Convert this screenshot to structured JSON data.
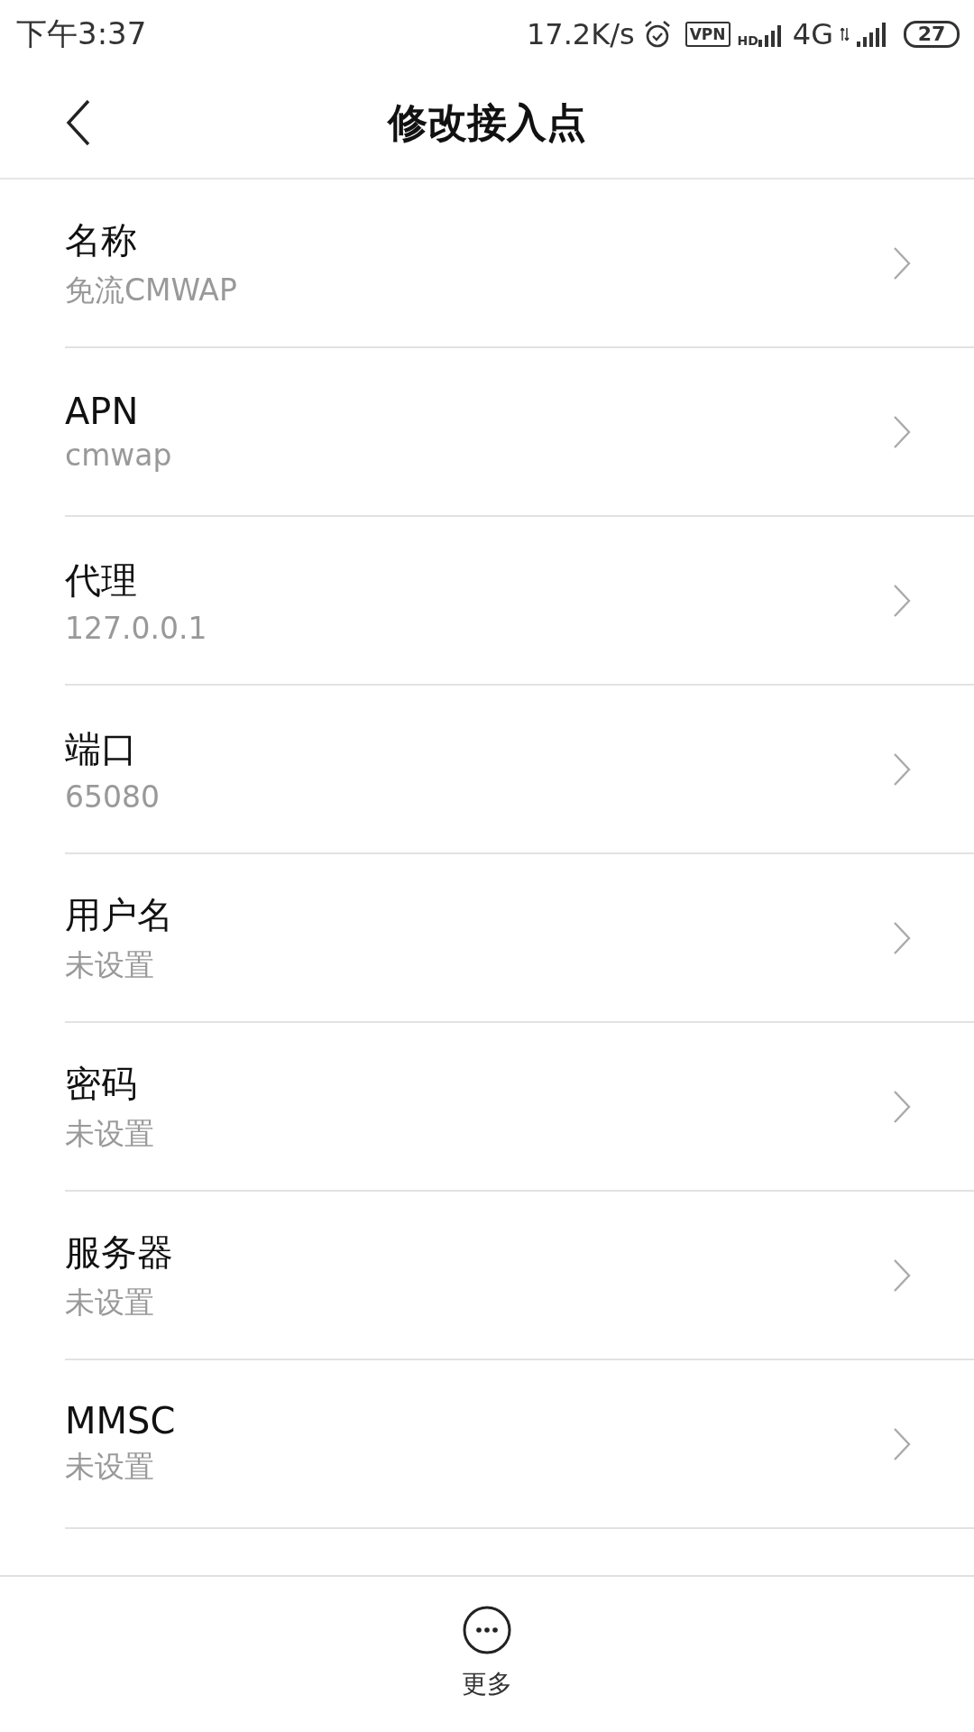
{
  "status_bar": {
    "time": "下午3:37",
    "speed": "17.2K/s",
    "vpn": "VPN",
    "hd": "HD",
    "network": "4G",
    "battery": "27"
  },
  "header": {
    "title": "修改接入点"
  },
  "items": [
    {
      "label": "名称",
      "value": "免流CMWAP"
    },
    {
      "label": "APN",
      "value": "cmwap"
    },
    {
      "label": "代理",
      "value": "127.0.0.1"
    },
    {
      "label": "端口",
      "value": "65080"
    },
    {
      "label": "用户名",
      "value": "未设置"
    },
    {
      "label": "密码",
      "value": "未设置"
    },
    {
      "label": "服务器",
      "value": "未设置"
    },
    {
      "label": "MMSC",
      "value": "未设置"
    }
  ],
  "bottom_bar": {
    "more_label": "更多"
  }
}
